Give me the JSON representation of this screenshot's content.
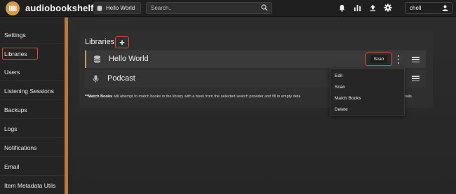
{
  "app": {
    "title": "audiobookshelf",
    "library_select": "Hello World",
    "search_placeholder": "Search..",
    "user": "chell"
  },
  "top_icons": [
    "bell-icon",
    "stats-icon",
    "upload-icon",
    "gear-icon"
  ],
  "sidebar": {
    "items": [
      {
        "label": "Settings"
      },
      {
        "label": "Libraries",
        "active": true
      },
      {
        "label": "Users"
      },
      {
        "label": "Listening Sessions"
      },
      {
        "label": "Backups"
      },
      {
        "label": "Logs"
      },
      {
        "label": "Notifications"
      },
      {
        "label": "Email"
      },
      {
        "label": "Item Metadata Utils"
      }
    ]
  },
  "libraries": {
    "title": "Libraries",
    "add_label": "+",
    "rows": [
      {
        "name": "Hello World",
        "icon": "database-icon"
      },
      {
        "name": "Podcast",
        "icon": "microphone-icon"
      }
    ],
    "scan_label": "Scan",
    "note_bold": "**Match Books",
    "note_text": " will attempt to match books in the library with a book from the selected search provider and fill in empty deta",
    "note_tail": "tails."
  },
  "dropdown": {
    "items": [
      "Edit",
      "Scan",
      "Match Books",
      "Delete"
    ]
  },
  "colors": {
    "accent": "#d49a4a",
    "highlight": "#e34a2e"
  }
}
